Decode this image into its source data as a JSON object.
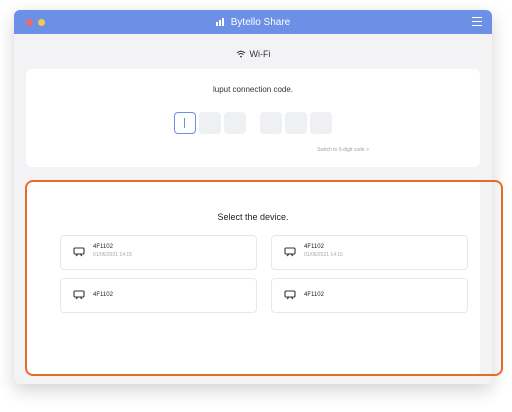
{
  "window": {
    "title": "Bytello Share",
    "brand_color": "#6b90e6"
  },
  "network": {
    "label": "Wi-Fi",
    "icon": "wifi-icon"
  },
  "connection": {
    "prompt": "luput connection code.",
    "digits": [
      "",
      "",
      "",
      "",
      "",
      ""
    ],
    "switch_label": "Switch to 6-digit code >"
  },
  "devices": {
    "prompt": "Select the device.",
    "items": [
      {
        "name": "4F1102",
        "date": "01/06/2021 14:15",
        "icon": "device-icon"
      },
      {
        "name": "4F1102",
        "date": "01/06/2021 14:15",
        "icon": "device-icon"
      },
      {
        "name": "4F1102",
        "date": "",
        "icon": "device-icon"
      },
      {
        "name": "4F1102",
        "date": "",
        "icon": "device-icon"
      }
    ]
  },
  "highlight_color": "#e86a2b"
}
